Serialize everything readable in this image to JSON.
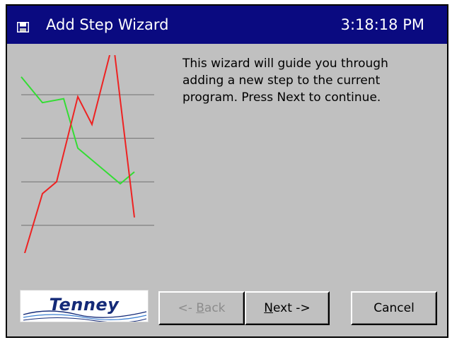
{
  "window": {
    "title": "Add Step Wizard",
    "clock": "3:18:18 PM",
    "title_bar_color": "#0a0a80",
    "app_icon": "floppy-disk-icon"
  },
  "content": {
    "message": "This wizard will guide you through\nadding a new step to the current\nprogram.  Press Next to continue."
  },
  "logo": {
    "text": "Tenney"
  },
  "buttons": {
    "back": {
      "label": "<- Back",
      "mnemonic": "B",
      "enabled": false
    },
    "next": {
      "label": "Next ->",
      "mnemonic": "N",
      "enabled": true
    },
    "cancel": {
      "label": "Cancel",
      "enabled": true
    }
  },
  "chart_data": {
    "type": "line",
    "decorative": true,
    "ylim": [
      0,
      100
    ],
    "xlim": [
      0,
      9
    ],
    "grid": true,
    "gridlines": [
      80,
      58,
      36,
      14
    ],
    "series": [
      {
        "color": "#33dd33",
        "x": [
          0,
          1.5,
          3,
          4,
          7,
          8
        ],
        "values": [
          89,
          76,
          78,
          53,
          35,
          41
        ]
      },
      {
        "color": "#ee2222",
        "x": [
          0,
          1.5,
          2.5,
          4,
          5,
          6.5,
          8
        ],
        "values": [
          -6,
          30,
          36,
          79,
          65,
          107,
          18
        ]
      }
    ]
  }
}
